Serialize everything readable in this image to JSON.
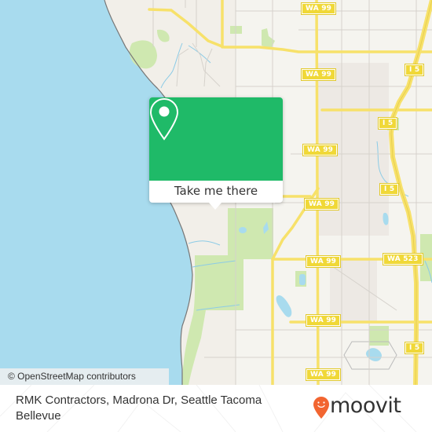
{
  "map": {
    "colors": {
      "water": "#a8dbee",
      "land": "#f2efe9",
      "park": "#cfe8b0",
      "highway": "#f7e16a",
      "shield": "#f0d838",
      "rail": "#777777",
      "stream": "#8ccbe6"
    },
    "shields": [
      {
        "label": "WA 99"
      },
      {
        "label": "WA 99"
      },
      {
        "label": "I 5"
      },
      {
        "label": "I 5"
      },
      {
        "label": "WA 99"
      },
      {
        "label": "I 5"
      },
      {
        "label": "WA 99"
      },
      {
        "label": "WA 99"
      },
      {
        "label": "WA 523"
      },
      {
        "label": "WA 99"
      },
      {
        "label": "I 5"
      },
      {
        "label": "WA 99"
      }
    ],
    "attribution": "© OpenStreetMap contributors"
  },
  "popup": {
    "icon": "location-pin-icon",
    "button_label": "Take me there",
    "accent": "#1fba68"
  },
  "footer": {
    "place_name": "RMK Contractors, Madrona Dr, Seattle Tacoma Bellevue",
    "brand": "moovit",
    "brand_color": "#f26530"
  }
}
